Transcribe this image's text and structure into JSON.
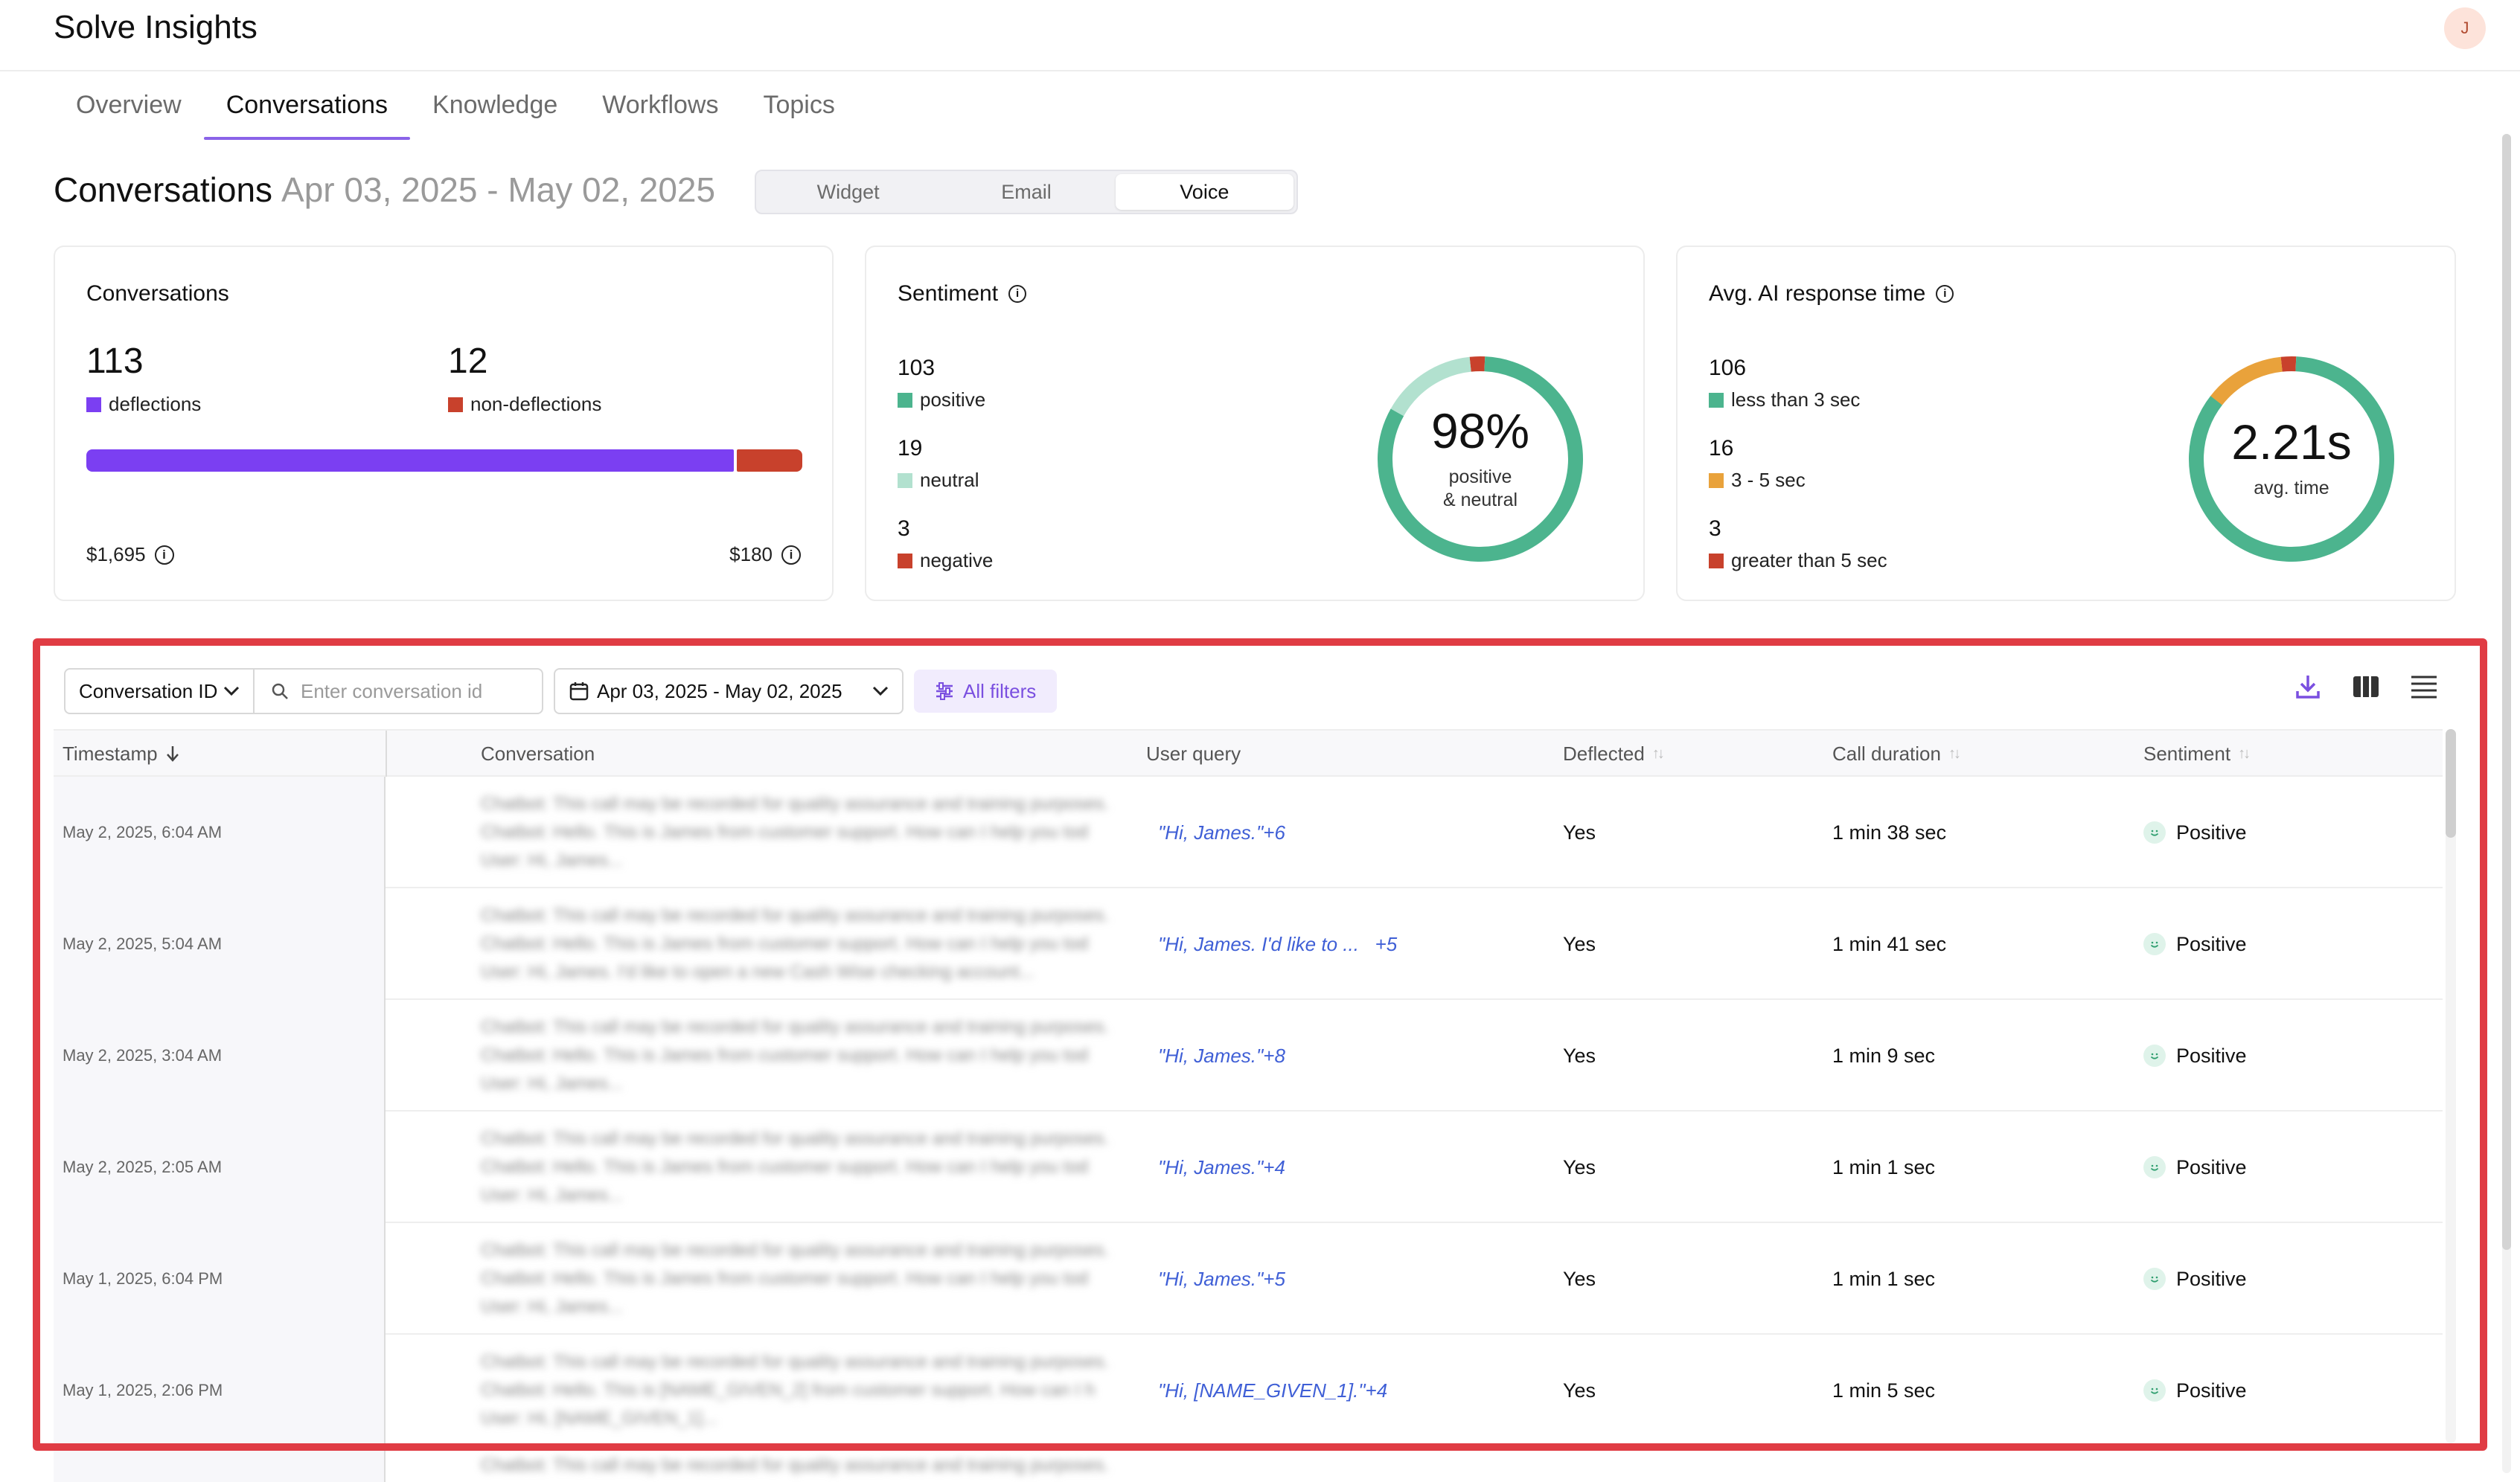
{
  "app": {
    "title": "Solve Insights",
    "avatar_initial": "J"
  },
  "tabs": [
    {
      "label": "Overview"
    },
    {
      "label": "Conversations"
    },
    {
      "label": "Knowledge"
    },
    {
      "label": "Workflows"
    },
    {
      "label": "Topics"
    }
  ],
  "active_tab": "Conversations",
  "heading": {
    "title": "Conversations",
    "date_range": "Apr 03, 2025 - May 02, 2025"
  },
  "channel_switch": {
    "options": [
      "Widget",
      "Email",
      "Voice"
    ],
    "selected": "Voice"
  },
  "cards": {
    "conversations": {
      "title": "Conversations",
      "deflections": {
        "value": "113",
        "label": "deflections",
        "color": "#7b3ff2"
      },
      "non_deflections": {
        "value": "12",
        "label": "non-deflections",
        "color": "#c8412c"
      },
      "deflection_share": 0.904,
      "savings_left": "$1,695",
      "savings_right": "$180"
    },
    "sentiment": {
      "title": "Sentiment",
      "items": [
        {
          "value": "103",
          "label": "positive",
          "color": "#4cb48e"
        },
        {
          "value": "19",
          "label": "neutral",
          "color": "#b2e1cf"
        },
        {
          "value": "3",
          "label": "negative",
          "color": "#c8412c"
        }
      ],
      "donut_value": "98%",
      "donut_caption": "positive\n& neutral"
    },
    "response_time": {
      "title": "Avg. AI response time",
      "items": [
        {
          "value": "106",
          "label": "less than 3 sec",
          "color": "#4cb48e"
        },
        {
          "value": "16",
          "label": "3 - 5 sec",
          "color": "#e9a23b"
        },
        {
          "value": "3",
          "label": "greater than 5 sec",
          "color": "#c8412c"
        }
      ],
      "donut_value": "2.21s",
      "donut_caption": "avg. time"
    }
  },
  "filters": {
    "field_select": "Conversation ID",
    "search_placeholder": "Enter conversation id",
    "date_range": "Apr 03, 2025 - May 02, 2025",
    "all_filters_label": "All filters"
  },
  "table": {
    "columns": {
      "timestamp": "Timestamp",
      "conversation": "Conversation",
      "user_query": "User query",
      "deflected": "Deflected",
      "call_duration": "Call duration",
      "sentiment": "Sentiment"
    },
    "rows": [
      {
        "timestamp": "May 2, 2025, 6:04 AM",
        "conv": [
          "Chatbot: This call may be recorded for quality assurance and training purposes.",
          "Chatbot: Hello. This is James from customer support. How can I help you tod",
          "User: Hi, James..."
        ],
        "query": "\"Hi, James.\"+6",
        "deflected": "Yes",
        "duration": "1 min 38 sec",
        "sentiment": "Positive"
      },
      {
        "timestamp": "May 2, 2025, 5:04 AM",
        "conv": [
          "Chatbot: This call may be recorded for quality assurance and training purposes.",
          "Chatbot: Hello. This is James from customer support. How can I help you tod",
          "User: Hi, James. I'd like to open a new Cash Wise checking account..."
        ],
        "query": "\"Hi, James. I'd like to ...   +5",
        "deflected": "Yes",
        "duration": "1 min 41 sec",
        "sentiment": "Positive"
      },
      {
        "timestamp": "May 2, 2025, 3:04 AM",
        "conv": [
          "Chatbot: This call may be recorded for quality assurance and training purposes.",
          "Chatbot: Hello. This is James from customer support. How can I help you tod",
          "User: Hi, James..."
        ],
        "query": "\"Hi, James.\"+8",
        "deflected": "Yes",
        "duration": "1 min 9 sec",
        "sentiment": "Positive"
      },
      {
        "timestamp": "May 2, 2025, 2:05 AM",
        "conv": [
          "Chatbot: This call may be recorded for quality assurance and training purposes.",
          "Chatbot: Hello. This is James from customer support. How can I help you tod",
          "User: Hi, James..."
        ],
        "query": "\"Hi, James.\"+4",
        "deflected": "Yes",
        "duration": "1 min 1 sec",
        "sentiment": "Positive"
      },
      {
        "timestamp": "May 1, 2025, 6:04 PM",
        "conv": [
          "Chatbot: This call may be recorded for quality assurance and training purposes.",
          "Chatbot: Hello. This is James from customer support. How can I help you tod",
          "User: Hi, James..."
        ],
        "query": "\"Hi, James.\"+5",
        "deflected": "Yes",
        "duration": "1 min 1 sec",
        "sentiment": "Positive"
      },
      {
        "timestamp": "May 1, 2025, 2:06 PM",
        "conv": [
          "Chatbot: This call may be recorded for quality assurance and training purposes.",
          "Chatbot: Hello. This is [NAME_GIVEN_2] from customer support. How can I h",
          "User: Hi, [NAME_GIVEN_1]..."
        ],
        "query": "\"Hi, [NAME_GIVEN_1].\"+4",
        "deflected": "Yes",
        "duration": "1 min 5 sec",
        "sentiment": "Positive"
      }
    ],
    "peek_row_text": "Chatbot: This call may be recorded for quality assurance and training purposes."
  }
}
